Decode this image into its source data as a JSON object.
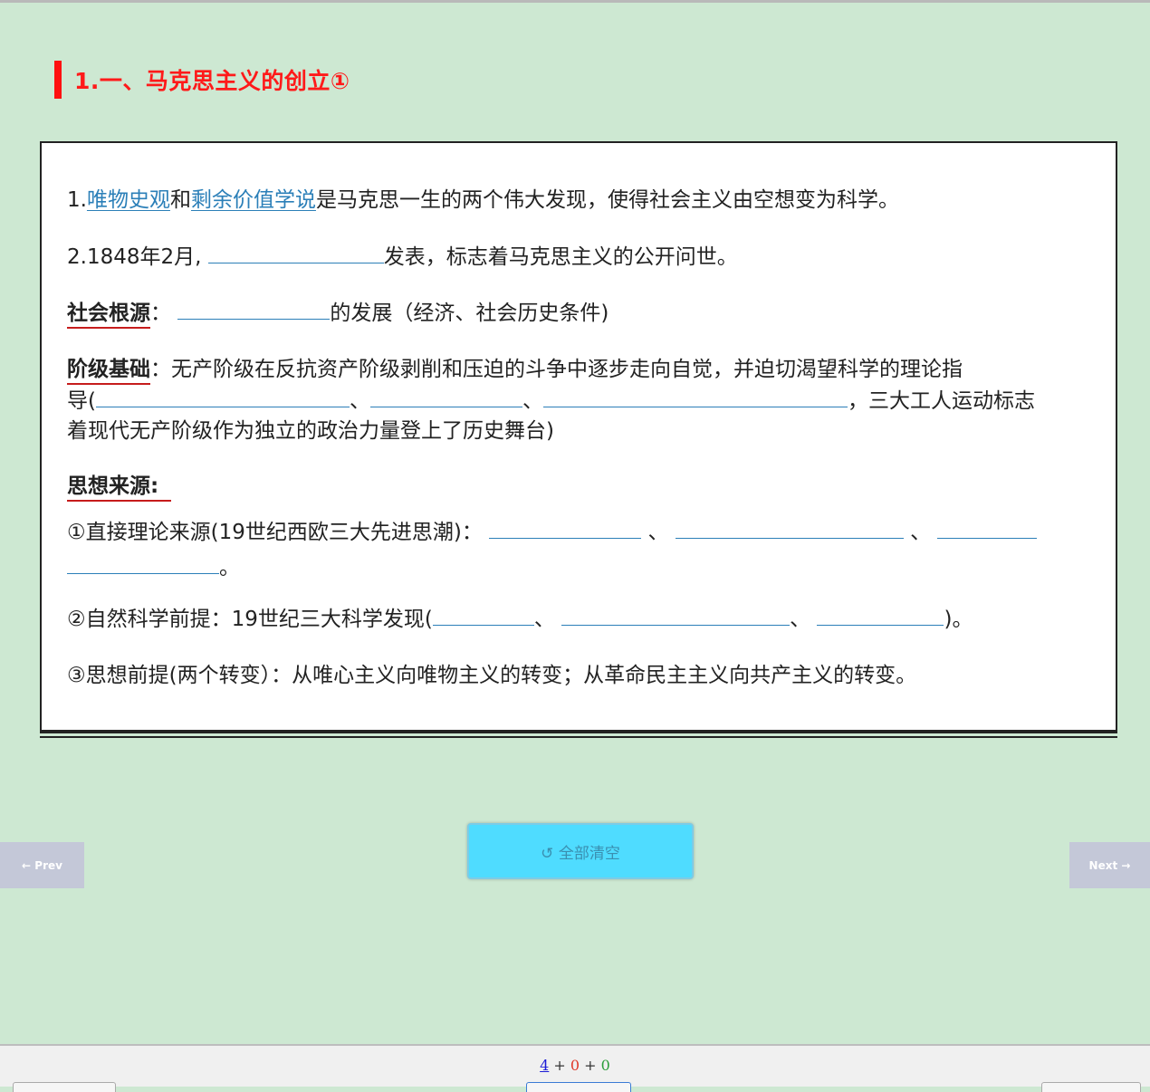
{
  "title": "1.一、马克思主义的创立①",
  "line1": {
    "num": "1.",
    "kw1": "唯物史观",
    "mid": "和",
    "kw2": "剩余价值学说",
    "rest": "是马克思一生的两个伟大发现，使得社会主义由空想变为科学。"
  },
  "line2": {
    "prefix": "2.1848年2月,",
    "suffix": "发表，标志着马克思主义的公开问世。"
  },
  "social": {
    "head": "社会根源",
    "colon": "：",
    "suffix": "的发展（经济、社会历史条件)"
  },
  "class_basis": {
    "head": "阶级基础",
    "text1": "：无产阶级在反抗资产阶级剥削和压迫的斗争中逐步走向自觉，并迫切渴望科学的理论指",
    "text2a": "导(",
    "sep1": "、",
    "sep2": "、",
    "text2b": "，三大工人运动标志",
    "text3": "着现代无产阶级作为独立的政治力量登上了历史舞台)"
  },
  "thought": {
    "head": "思想来源:"
  },
  "item1": {
    "text": "①直接理论来源(19世纪西欧三大先进思潮)：",
    "sep1": "、",
    "sep2": "、",
    "end": "。"
  },
  "item2": {
    "text": "②自然科学前提：19世纪三大科学发现(",
    "sep1": "、",
    "sep2": "、",
    "end": ")。"
  },
  "item3": {
    "text": "③思想前提(两个转变）：从唯心主义向唯物主义的转变；从革命民主主义向共产主义的转变。"
  },
  "clear_button": "↺ 全部清空",
  "prev_button": "← Prev",
  "next_button": "Next →",
  "footer_counter": {
    "a": "4",
    "plus1": " + ",
    "b": "0",
    "plus2": " + ",
    "c": "0"
  }
}
